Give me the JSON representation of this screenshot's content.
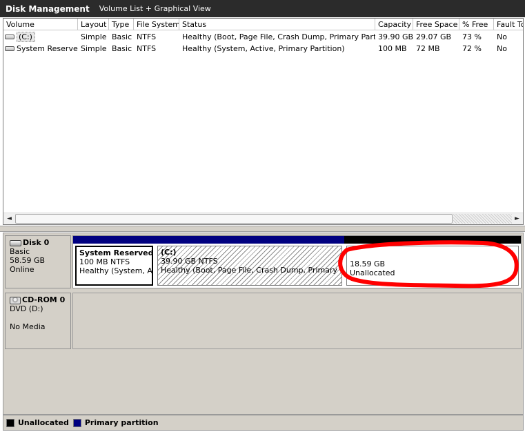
{
  "title": {
    "app": "Disk Management",
    "view": "Volume List + Graphical View"
  },
  "columns": [
    "Volume",
    "Layout",
    "Type",
    "File System",
    "Status",
    "Capacity",
    "Free Space",
    "% Free",
    "Fault To"
  ],
  "volumes": [
    {
      "name": "(C:)",
      "layout": "Simple",
      "type": "Basic",
      "fs": "NTFS",
      "status": "Healthy (Boot, Page File, Crash Dump, Primary Partition)",
      "capacity": "39.90 GB",
      "free": "29.07 GB",
      "pct": "73 %",
      "fault": "No"
    },
    {
      "name": "System Reserved",
      "layout": "Simple",
      "type": "Basic",
      "fs": "NTFS",
      "status": "Healthy (System, Active, Primary Partition)",
      "capacity": "100 MB",
      "free": "72 MB",
      "pct": "72 %",
      "fault": "No"
    }
  ],
  "scroll": {
    "left_arrow": "◄",
    "right_arrow": "►"
  },
  "disks": {
    "disk0": {
      "name": "Disk 0",
      "type": "Basic",
      "size": "58.59 GB",
      "status": "Online",
      "partitions": [
        {
          "name": "System Reserved",
          "size_fs": "100 MB NTFS",
          "status": "Healthy (System, Acti"
        },
        {
          "name": "(C:)",
          "size_fs": "39.90 GB NTFS",
          "status": "Healthy (Boot, Page File, Crash Dump, Primary Partitic"
        },
        {
          "size": "18.59 GB",
          "label": "Unallocated"
        }
      ]
    },
    "cdrom0": {
      "name": "CD-ROM 0",
      "type": "DVD (D:)",
      "media": "No Media"
    }
  },
  "legend": {
    "unallocated": "Unallocated",
    "primary": "Primary partition"
  },
  "colors": {
    "primary": "#000080",
    "unallocated": "#000000",
    "highlight": "#ff0000"
  }
}
